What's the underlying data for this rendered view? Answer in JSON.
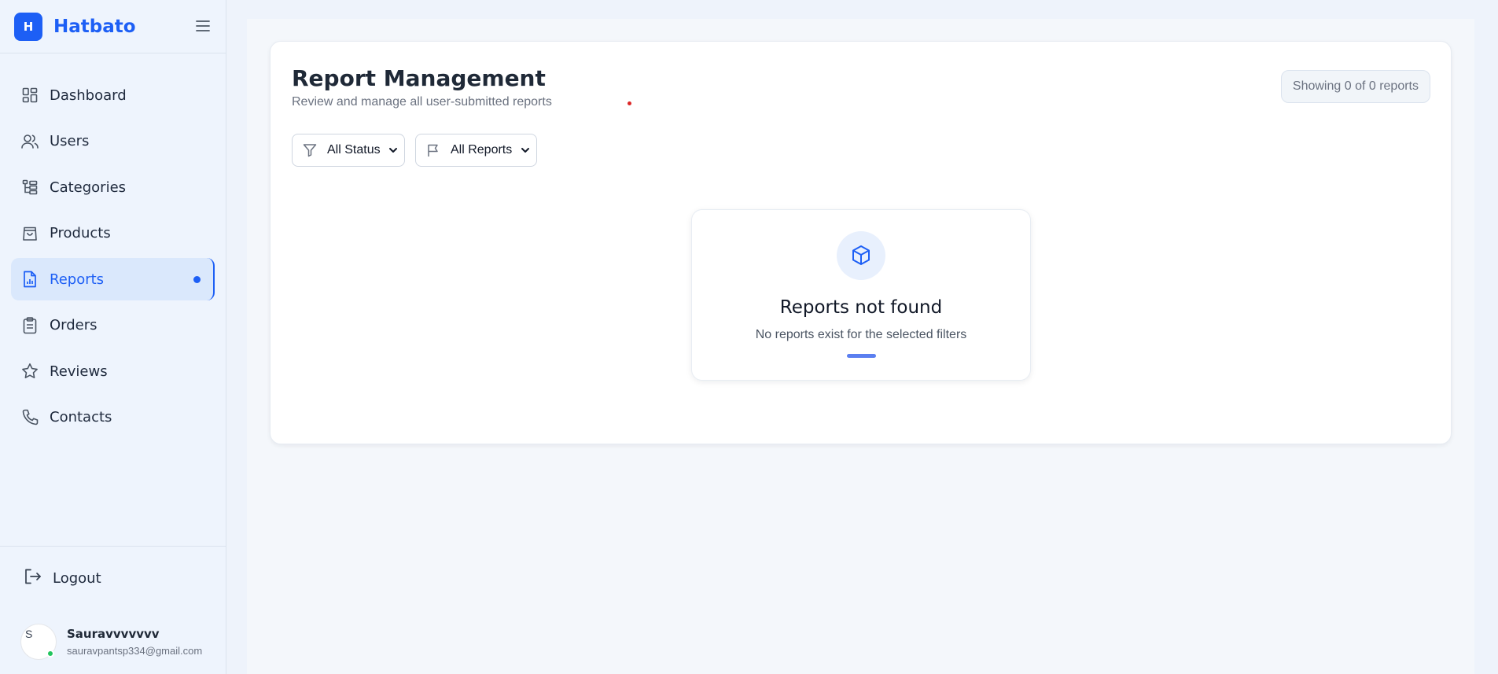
{
  "brand": {
    "logo_letter": "H",
    "name": "Hatbato",
    "accent": "#1d5ff5"
  },
  "sidebar": {
    "items": [
      {
        "label": "Dashboard",
        "icon": "dashboard-grid-icon",
        "active": false
      },
      {
        "label": "Users",
        "icon": "users-icon",
        "active": false
      },
      {
        "label": "Categories",
        "icon": "categories-tree-icon",
        "active": false
      },
      {
        "label": "Products",
        "icon": "shopping-bag-icon",
        "active": false
      },
      {
        "label": "Reports",
        "icon": "report-chart-icon",
        "active": true
      },
      {
        "label": "Orders",
        "icon": "clipboard-icon",
        "active": false
      },
      {
        "label": "Reviews",
        "icon": "star-icon",
        "active": false
      },
      {
        "label": "Contacts",
        "icon": "phone-icon",
        "active": false
      }
    ],
    "logout_label": "Logout",
    "user": {
      "avatar_alt": "S",
      "name": "Sauravvvvvvv",
      "email": "sauravpantsp334@gmail.com",
      "online": true
    }
  },
  "main": {
    "title": "Report Management",
    "subtitle": "Review and manage all user-submitted reports",
    "count_badge": "Showing 0 of 0 reports",
    "filters": {
      "status": {
        "selected": "All Status",
        "icon": "filter-funnel-icon"
      },
      "reports": {
        "selected": "All Reports",
        "icon": "flag-icon"
      }
    },
    "empty_state": {
      "icon": "cube-box-icon",
      "title": "Reports not found",
      "message": "No reports exist for the selected filters"
    }
  }
}
